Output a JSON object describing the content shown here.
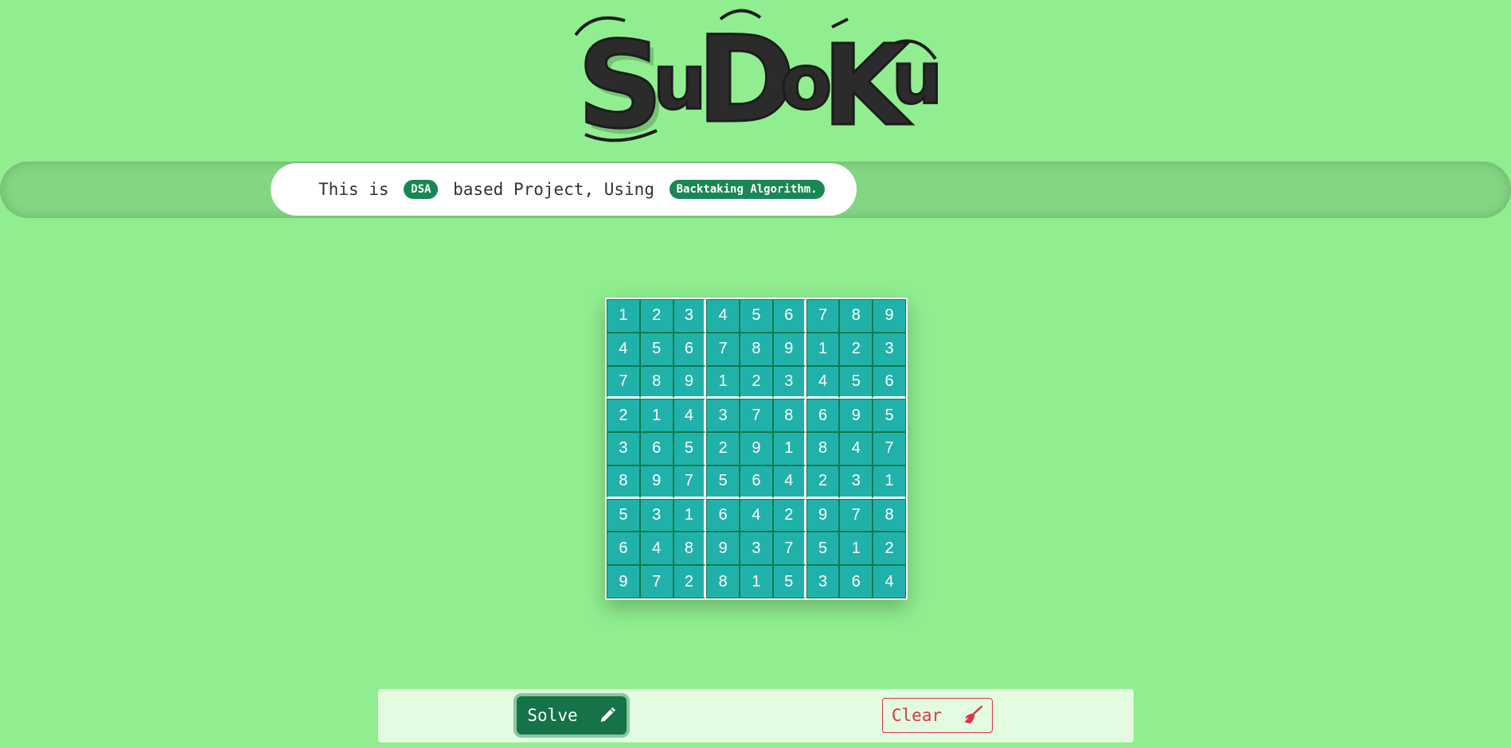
{
  "logo": {
    "text": "SuDoKu"
  },
  "banner": {
    "prefix": "This is ",
    "pill1": "DSA",
    "middle": " based Project, Using ",
    "pill2": "Backtaking Algorithm."
  },
  "grid": [
    [
      "1",
      "2",
      "3",
      "4",
      "5",
      "6",
      "7",
      "8",
      "9"
    ],
    [
      "4",
      "5",
      "6",
      "7",
      "8",
      "9",
      "1",
      "2",
      "3"
    ],
    [
      "7",
      "8",
      "9",
      "1",
      "2",
      "3",
      "4",
      "5",
      "6"
    ],
    [
      "2",
      "1",
      "4",
      "3",
      "7",
      "8",
      "6",
      "9",
      "5"
    ],
    [
      "3",
      "6",
      "5",
      "2",
      "9",
      "1",
      "8",
      "4",
      "7"
    ],
    [
      "8",
      "9",
      "7",
      "5",
      "6",
      "4",
      "2",
      "3",
      "1"
    ],
    [
      "5",
      "3",
      "1",
      "6",
      "4",
      "2",
      "9",
      "7",
      "8"
    ],
    [
      "6",
      "4",
      "8",
      "9",
      "3",
      "7",
      "5",
      "1",
      "2"
    ],
    [
      "9",
      "7",
      "2",
      "8",
      "1",
      "5",
      "3",
      "6",
      "4"
    ]
  ],
  "buttons": {
    "solve_label": "Solve",
    "solve_icon": "pencil-icon",
    "clear_label": "Clear",
    "clear_icon": "broom-icon"
  },
  "colors": {
    "background": "#90ee90",
    "cell": "#20b2aa",
    "solve": "#157347",
    "clear": "#dc3545",
    "pill": "#198754"
  }
}
